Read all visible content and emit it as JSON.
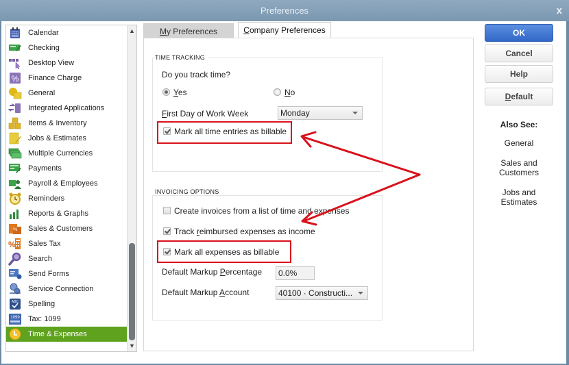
{
  "window": {
    "title": "Preferences",
    "close_label": "x"
  },
  "sidebar": {
    "items": [
      {
        "label": "Calendar",
        "icon": "calendar-icon"
      },
      {
        "label": "Checking",
        "icon": "checking-icon"
      },
      {
        "label": "Desktop View",
        "icon": "desktop-view-icon"
      },
      {
        "label": "Finance Charge",
        "icon": "percent-icon"
      },
      {
        "label": "General",
        "icon": "general-icon"
      },
      {
        "label": "Integrated Applications",
        "icon": "integrated-apps-icon"
      },
      {
        "label": "Items & Inventory",
        "icon": "boxes-icon"
      },
      {
        "label": "Jobs & Estimates",
        "icon": "notepad-icon"
      },
      {
        "label": "Multiple Currencies",
        "icon": "currency-icon"
      },
      {
        "label": "Payments",
        "icon": "payments-icon"
      },
      {
        "label": "Payroll & Employees",
        "icon": "payroll-icon"
      },
      {
        "label": "Reminders",
        "icon": "alarm-clock-icon"
      },
      {
        "label": "Reports & Graphs",
        "icon": "bar-chart-icon"
      },
      {
        "label": "Sales & Customers",
        "icon": "sales-icon"
      },
      {
        "label": "Sales Tax",
        "icon": "sales-tax-icon"
      },
      {
        "label": "Search",
        "icon": "search-icon"
      },
      {
        "label": "Send Forms",
        "icon": "send-forms-icon"
      },
      {
        "label": "Service Connection",
        "icon": "service-connection-icon"
      },
      {
        "label": "Spelling",
        "icon": "spelling-icon"
      },
      {
        "label": "Tax: 1099",
        "icon": "tax-1099-icon"
      },
      {
        "label": "Time & Expenses",
        "icon": "clock-icon",
        "selected": true
      }
    ]
  },
  "tabs": {
    "my_preferences": {
      "prefix": "",
      "accel": "M",
      "rest": "y Preferences"
    },
    "company_preferences": {
      "prefix": "",
      "accel": "C",
      "rest": "ompany Preferences"
    }
  },
  "time_tracking": {
    "group_label": "TIME TRACKING",
    "question": "Do you track time?",
    "yes": {
      "accel": "Y",
      "rest": "es",
      "selected": true
    },
    "no": {
      "accel": "N",
      "rest": "o",
      "selected": false
    },
    "first_day_label": {
      "accel": "F",
      "rest": "irst Day of Work Week"
    },
    "first_day_value": "Monday",
    "mark_time_billable": {
      "label": "Mark all time entries as billable",
      "checked": true
    }
  },
  "invoicing_options": {
    "group_label": "INVOICING OPTIONS",
    "create_invoices": {
      "label": "Create invoices from a list of time and expenses",
      "checked": false
    },
    "track_reimbursed": {
      "pre": "Track ",
      "accel": "r",
      "rest": "eimbursed expenses as income",
      "checked": true
    },
    "mark_expenses_billable": {
      "label": "Mark all expenses as billable",
      "checked": true
    },
    "markup_percentage_label": {
      "pre": "Default Markup ",
      "accel": "P",
      "rest": "ercentage"
    },
    "markup_percentage_value": "0.0%",
    "markup_account_label": {
      "pre": "Default Markup ",
      "accel": "A",
      "rest": "ccount"
    },
    "markup_account_value": "40100 · Constructi..."
  },
  "buttons": {
    "ok": "OK",
    "cancel": "Cancel",
    "help": "Help",
    "default": {
      "accel": "D",
      "rest": "efault"
    }
  },
  "also_see": {
    "header": "Also See:",
    "links": [
      "General",
      "Sales and\nCustomers",
      "Jobs and\nEstimates"
    ],
    "link_lines": [
      [
        "General"
      ],
      [
        "Sales and",
        "Customers"
      ],
      [
        "Jobs and",
        "Estimates"
      ]
    ]
  },
  "annotation": {
    "color": "#d9111c"
  }
}
